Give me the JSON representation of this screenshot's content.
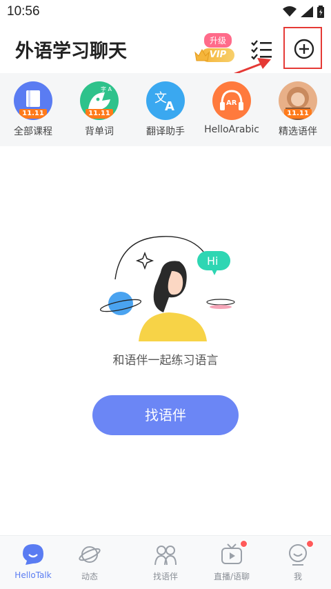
{
  "status": {
    "time": "10:56"
  },
  "header": {
    "title": "外语学习聊天",
    "vip_upgrade": "升级",
    "vip_label": "VIP"
  },
  "quick_items": [
    {
      "label": "全部课程",
      "icon": "course-book-icon",
      "color": "#5a7cf2",
      "tag": "11.11"
    },
    {
      "label": "背单词",
      "icon": "word-mascot-icon",
      "color": "#2ec28b",
      "tag": "11.11"
    },
    {
      "label": "翻译助手",
      "icon": "translate-icon",
      "color": "#3aa8f0"
    },
    {
      "label": "HelloArabic",
      "icon": "ar-headphones-icon",
      "color": "#ff7a3d"
    },
    {
      "label": "精选语伴",
      "icon": "partner-avatar-icon",
      "color": "#e8b088",
      "tag": "11.11"
    }
  ],
  "main": {
    "hi_bubble": "Hi",
    "empty_text": "和语伴一起练习语言",
    "find_button": "找语伴"
  },
  "tabs": [
    {
      "label": "HelloTalk",
      "icon": "hellotalk-chat-icon",
      "active": true
    },
    {
      "label": "动态",
      "icon": "planet-icon",
      "active": false
    },
    {
      "label": "找语伴",
      "icon": "people-icon",
      "active": false
    },
    {
      "label": "直播/语聊",
      "icon": "tv-live-icon",
      "active": false,
      "badge": true
    },
    {
      "label": "我",
      "icon": "profile-face-icon",
      "active": false,
      "badge": true
    }
  ],
  "colors": {
    "accent": "#6b86f5",
    "highlight_box": "#e53935",
    "tab_active": "#5a7cf2"
  }
}
